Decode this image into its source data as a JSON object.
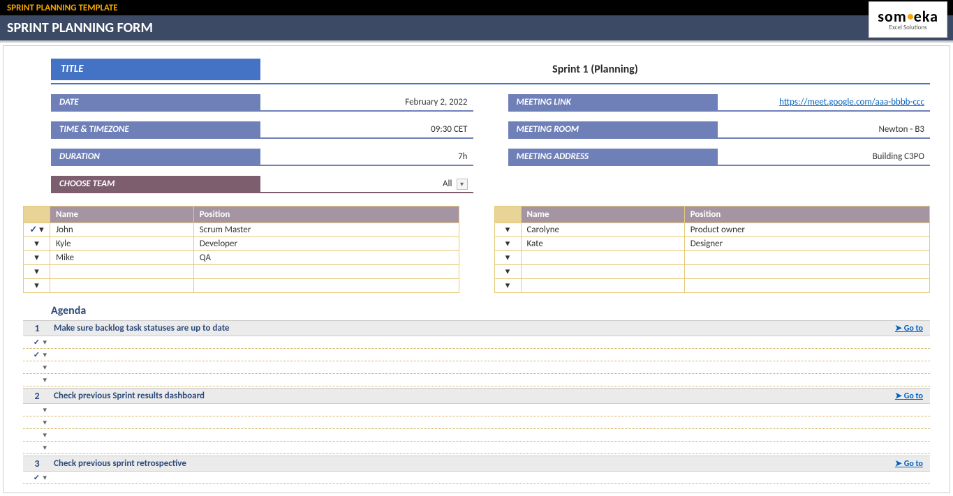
{
  "topbar": {
    "template_name": "SPRINT PLANNING TEMPLATE"
  },
  "logo": {
    "main_a": "som",
    "main_b": "eka",
    "sub": "Excel Solutions"
  },
  "header": {
    "title": "SPRINT PLANNING FORM"
  },
  "title": {
    "label": "TITLE",
    "value": "Sprint 1 (Planning)"
  },
  "left_fields": {
    "date": {
      "label": "DATE",
      "value": "February 2, 2022"
    },
    "time": {
      "label": "TIME & TIMEZONE",
      "value": "09:30 CET"
    },
    "duration": {
      "label": "DURATION",
      "value": "7h"
    },
    "team": {
      "label": "CHOOSE TEAM",
      "value": "All"
    }
  },
  "right_fields": {
    "link": {
      "label": "MEETING LINK",
      "value": "https://meet.google.com/aaa-bbbb-ccc"
    },
    "room": {
      "label": "MEETING ROOM",
      "value": "Newton - B3"
    },
    "address": {
      "label": "MEETING ADDRESS",
      "value": "Building C3PO"
    }
  },
  "team_table": {
    "headers": {
      "name": "Name",
      "position": "Position"
    },
    "left": [
      {
        "checked": true,
        "name": "John",
        "position": "Scrum Master"
      },
      {
        "checked": false,
        "name": "Kyle",
        "position": "Developer"
      },
      {
        "checked": false,
        "name": "Mike",
        "position": "QA"
      },
      {
        "checked": false,
        "name": "",
        "position": ""
      },
      {
        "checked": false,
        "name": "",
        "position": ""
      }
    ],
    "right": [
      {
        "checked": false,
        "name": "Carolyne",
        "position": "Product owner"
      },
      {
        "checked": false,
        "name": "Kate",
        "position": "Designer"
      },
      {
        "checked": false,
        "name": "",
        "position": ""
      },
      {
        "checked": false,
        "name": "",
        "position": ""
      },
      {
        "checked": false,
        "name": "",
        "position": ""
      }
    ]
  },
  "agenda": {
    "title": "Agenda",
    "goto": "Go to",
    "items": [
      {
        "num": "1",
        "text": "Make sure backlog task statuses are up to date",
        "subs": [
          true,
          true,
          false,
          false
        ]
      },
      {
        "num": "2",
        "text": "Check previous Sprint results dashboard",
        "subs": [
          false,
          false,
          false,
          false
        ]
      },
      {
        "num": "3",
        "text": "Check previous sprint retrospective",
        "subs": [
          true
        ]
      }
    ]
  }
}
